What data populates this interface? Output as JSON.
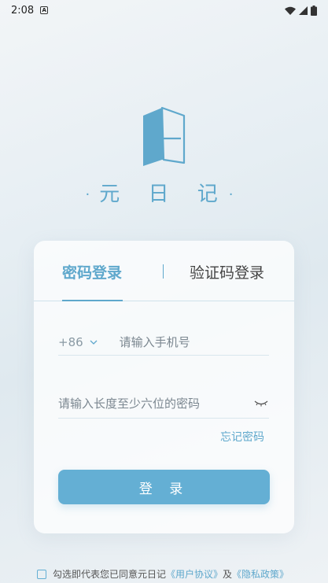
{
  "status_bar": {
    "time": "2:08",
    "notification_icon": "a-notification-icon"
  },
  "brand": {
    "name": "元 日 记",
    "dot": "·",
    "colors": {
      "accent": "#5fa8cc",
      "button": "#64afd4"
    }
  },
  "tabs": {
    "password_login": "密码登录",
    "code_login": "验证码登录"
  },
  "form": {
    "country_code": "+86",
    "phone_placeholder": "请输入手机号",
    "password_placeholder": "请输入长度至少六位的密码",
    "forgot_password": "忘记密码",
    "login_button": "登 录"
  },
  "agreement": {
    "prefix": "勾选即代表您已同意元日记",
    "user_agreement": "《用户协议》",
    "and": "及",
    "privacy_policy": "《隐私政策》"
  }
}
